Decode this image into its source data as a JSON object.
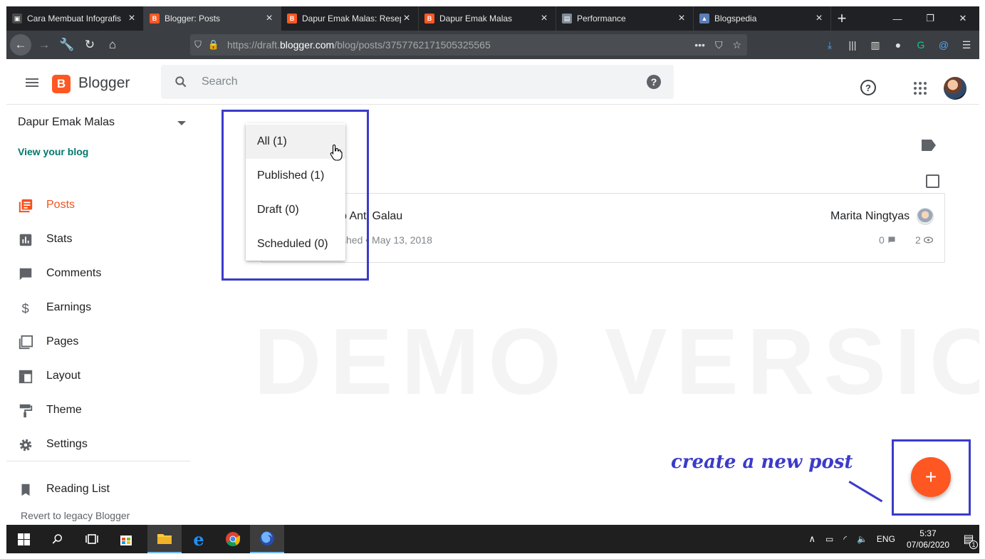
{
  "browser": {
    "tabs": [
      {
        "title": "Cara Membuat Infografis",
        "favicon_color": "#4a4a4a",
        "active": false
      },
      {
        "title": "Blogger: Posts",
        "favicon_color": "#ff5722",
        "active": true
      },
      {
        "title": "Dapur Emak Malas: Resep",
        "favicon_color": "#ff5722",
        "active": false
      },
      {
        "title": "Dapur Emak Malas",
        "favicon_color": "#ff5722",
        "active": false
      },
      {
        "title": "Performance",
        "favicon_color": "#7f8c9a",
        "active": false
      },
      {
        "title": "Blogspedia",
        "favicon_color": "#5b7db8",
        "active": false
      }
    ],
    "url_prefix": "https://draft.",
    "url_domain": "blogger.com",
    "url_path": "/blog/posts/3757762171505325565"
  },
  "header": {
    "brand": "Blogger",
    "search_placeholder": "Search"
  },
  "sidebar": {
    "blog_name": "Dapur Emak Malas",
    "view_blog": "View your blog",
    "items": [
      {
        "label": "Posts",
        "icon": "posts-icon",
        "active": true
      },
      {
        "label": "Stats",
        "icon": "stats-icon",
        "active": false
      },
      {
        "label": "Comments",
        "icon": "comments-icon",
        "active": false
      },
      {
        "label": "Earnings",
        "icon": "dollar-icon",
        "active": false
      },
      {
        "label": "Pages",
        "icon": "pages-icon",
        "active": false
      },
      {
        "label": "Layout",
        "icon": "layout-icon",
        "active": false
      },
      {
        "label": "Theme",
        "icon": "paint-roller-icon",
        "active": false
      },
      {
        "label": "Settings",
        "icon": "gear-icon",
        "active": false
      }
    ],
    "reading_list": "Reading List",
    "legacy": "Revert to legacy Blogger"
  },
  "filter_menu": {
    "options": [
      "All (1)",
      "Published (1)",
      "Draft (0)",
      "Scheduled (0)"
    ],
    "selected": "All (1)"
  },
  "post": {
    "title_visible": "p Anti Galau",
    "meta_visible": "shed • May 13, 2018",
    "author": "Marita Ningtyas",
    "comments": "0",
    "views": "2"
  },
  "annotation": {
    "text": "create a new post",
    "highlight_color": "#3b3bc9"
  },
  "watermark": "DEMO VERSION",
  "taskbar": {
    "language": "ENG",
    "time": "5:37",
    "date": "07/06/2020",
    "notifications": "1"
  },
  "colors": {
    "accent": "#ff5722",
    "link": "#00796b"
  }
}
